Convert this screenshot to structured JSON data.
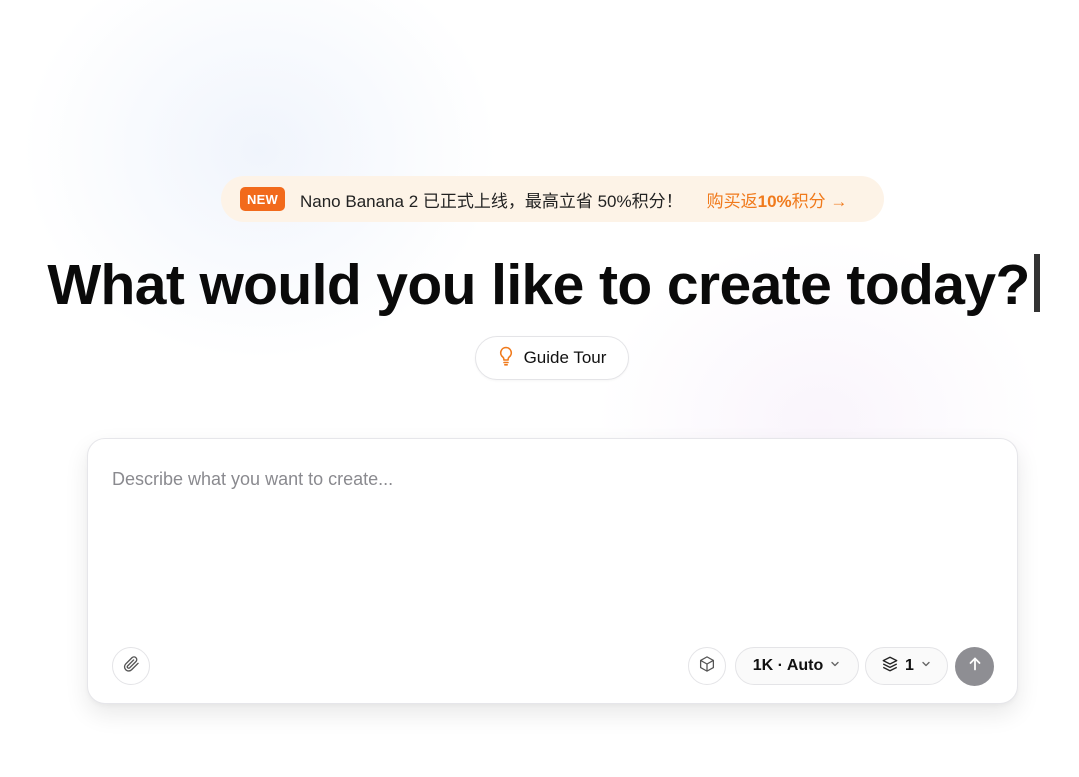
{
  "banner": {
    "badge": "NEW",
    "message": "Nano Banana 2 已正式上线，最高立省 50%积分！",
    "link_prefix": "购买返",
    "link_bold": "10%",
    "link_suffix": "积分 →"
  },
  "headline": "What would you like to create today?",
  "guide_tour": {
    "label": "Guide Tour",
    "icon": "lightbulb-icon"
  },
  "prompt": {
    "placeholder": "Describe what you want to create...",
    "value": ""
  },
  "toolbar": {
    "attach_icon": "paperclip-icon",
    "model_icon": "cube-icon",
    "resolution_label": "1K · Auto",
    "image_count_label": "1",
    "count_icon": "layers-icon",
    "send_icon": "arrow-up-icon"
  },
  "colors": {
    "accent": "#f26a1b",
    "link": "#f07a1c",
    "banner_bg": "#fdf3e7",
    "send_disabled": "#8e8e93"
  }
}
